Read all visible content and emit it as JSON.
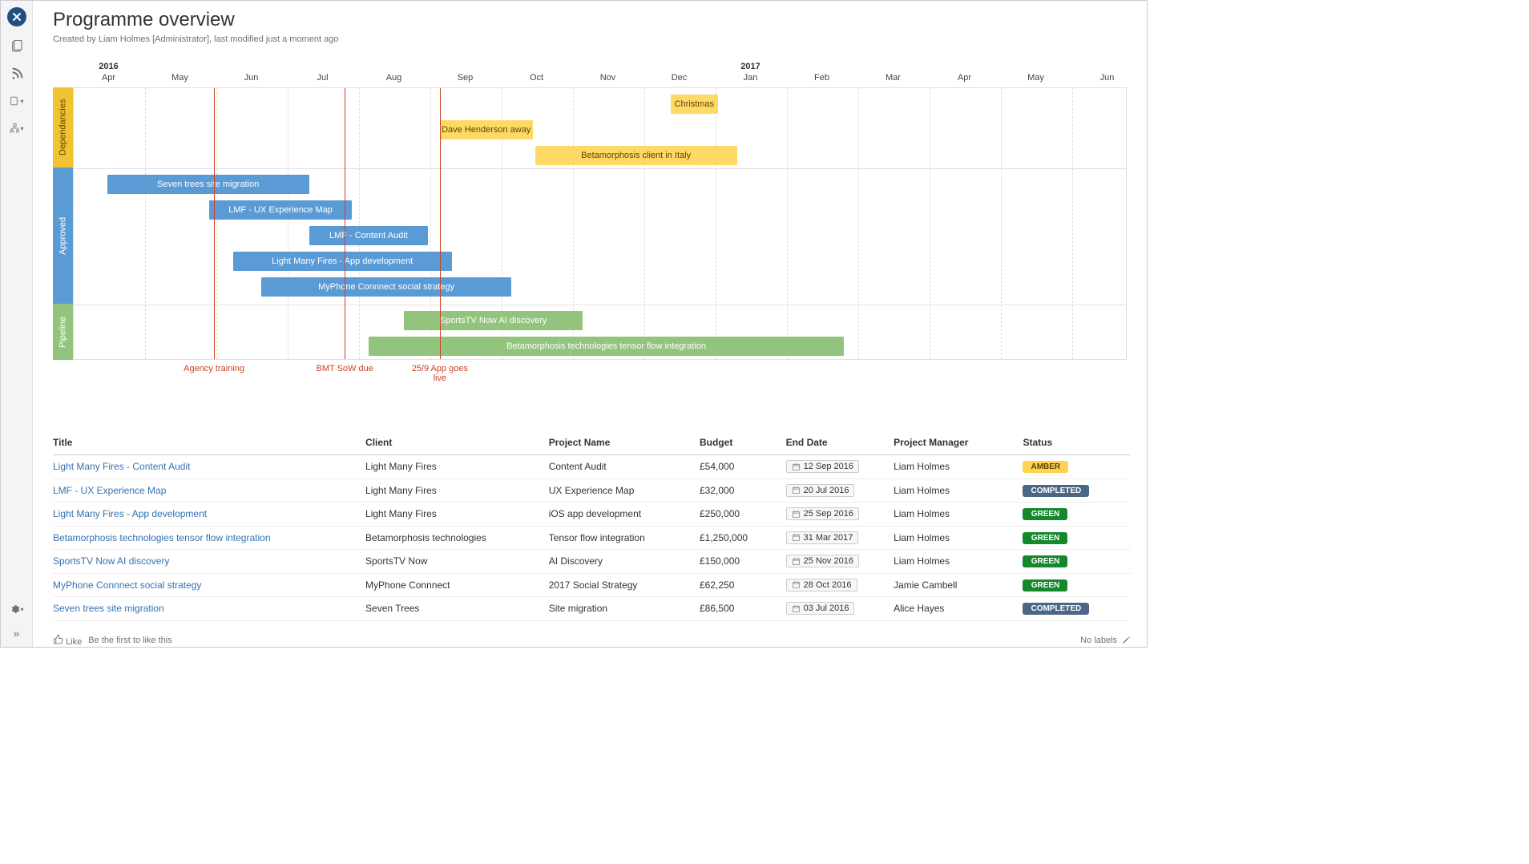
{
  "header": {
    "title": "Programme overview",
    "meta": "Created by Liam Holmes [Administrator], last modified just a moment ago"
  },
  "chart_data": {
    "type": "gantt",
    "x_axis": {
      "start": "2016-04",
      "end": "2017-06",
      "years": [
        {
          "label": "2016",
          "at": "2016-04"
        },
        {
          "label": "2017",
          "at": "2017-01"
        }
      ],
      "months": [
        "Apr",
        "May",
        "Jun",
        "Jul",
        "Aug",
        "Sep",
        "Oct",
        "Nov",
        "Dec",
        "Jan",
        "Feb",
        "Mar",
        "Apr",
        "May",
        "Jun"
      ]
    },
    "lanes": [
      {
        "id": "dependancies",
        "label": "Dependancies",
        "color": "#f1c232"
      },
      {
        "id": "approved",
        "label": "Approved",
        "color": "#5b9bd5"
      },
      {
        "id": "pipeline",
        "label": "Pipeline",
        "color": "#93c47d"
      }
    ],
    "bars": [
      {
        "lane": "dependancies",
        "label": "Christmas",
        "start": "2016-12-12",
        "end": "2017-01-02"
      },
      {
        "lane": "dependancies",
        "label": "Dave Henderson away",
        "start": "2016-09-05",
        "end": "2016-10-14"
      },
      {
        "lane": "dependancies",
        "label": "Betamorphosis client in Italy",
        "start": "2016-10-15",
        "end": "2017-01-10"
      },
      {
        "lane": "approved",
        "label": "Seven trees site migration",
        "start": "2016-04-15",
        "end": "2016-07-10"
      },
      {
        "lane": "approved",
        "label": "LMF - UX Experience Map",
        "start": "2016-05-28",
        "end": "2016-07-28"
      },
      {
        "lane": "approved",
        "label": "LMF - Content Audit",
        "start": "2016-07-10",
        "end": "2016-08-30"
      },
      {
        "lane": "approved",
        "label": "Light Many Fires - App development",
        "start": "2016-06-08",
        "end": "2016-09-10"
      },
      {
        "lane": "approved",
        "label": "MyPhone Connnect social strategy",
        "start": "2016-06-20",
        "end": "2016-10-05"
      },
      {
        "lane": "pipeline",
        "label": "SportsTV Now AI discovery",
        "start": "2016-08-20",
        "end": "2016-11-05"
      },
      {
        "lane": "pipeline",
        "label": "Betamorphosis technologies tensor flow integration",
        "start": "2016-08-05",
        "end": "2017-02-25"
      }
    ],
    "markers": [
      {
        "label": "Agency training",
        "at": "2016-05-30"
      },
      {
        "label": "BMT SoW due",
        "at": "2016-07-25"
      },
      {
        "label": "25/9 App goes live",
        "at": "2016-09-05",
        "multiline": true
      }
    ]
  },
  "table": {
    "headers": {
      "title": "Title",
      "client": "Client",
      "project": "Project Name",
      "budget": "Budget",
      "end": "End Date",
      "pm": "Project Manager",
      "status": "Status"
    },
    "rows": [
      {
        "title": "Light Many Fires - Content Audit",
        "client": "Light Many Fires",
        "project": "Content Audit",
        "budget": "£54,000",
        "end": "12 Sep 2016",
        "pm": "Liam Holmes",
        "status": "AMBER",
        "status_class": "amber"
      },
      {
        "title": "LMF - UX Experience Map",
        "client": "Light Many Fires",
        "project": "UX Experience Map",
        "budget": "£32,000",
        "end": "20 Jul 2016",
        "pm": "Liam Holmes",
        "status": "COMPLETED",
        "status_class": "completed"
      },
      {
        "title": "Light Many Fires - App development",
        "client": "Light Many Fires",
        "project": "iOS app development",
        "budget": "£250,000",
        "end": "25 Sep 2016",
        "pm": "Liam Holmes",
        "status": "GREEN",
        "status_class": "green"
      },
      {
        "title": "Betamorphosis technologies tensor flow integration",
        "client": "Betamorphosis technologies",
        "project": "Tensor flow integration",
        "budget": "£1,250,000",
        "end": "31 Mar 2017",
        "pm": "Liam Holmes",
        "status": "GREEN",
        "status_class": "green"
      },
      {
        "title": "SportsTV Now AI discovery",
        "client": "SportsTV Now",
        "project": "AI Discovery",
        "budget": "£150,000",
        "end": "25 Nov 2016",
        "pm": "Liam Holmes",
        "status": "GREEN",
        "status_class": "green"
      },
      {
        "title": "MyPhone Connnect social strategy",
        "client": "MyPhone Connnect",
        "project": "2017 Social Strategy",
        "budget": "£62,250",
        "end": "28 Oct 2016",
        "pm": "Jamie Cambell",
        "status": "GREEN",
        "status_class": "green"
      },
      {
        "title": "Seven trees site migration",
        "client": "Seven Trees",
        "project": "Site migration",
        "budget": "£86,500",
        "end": "03 Jul 2016",
        "pm": "Alice Hayes",
        "status": "COMPLETED",
        "status_class": "completed"
      }
    ]
  },
  "footer": {
    "like_label": "Like",
    "like_helper": "Be the first to like this",
    "no_labels": "No labels"
  }
}
